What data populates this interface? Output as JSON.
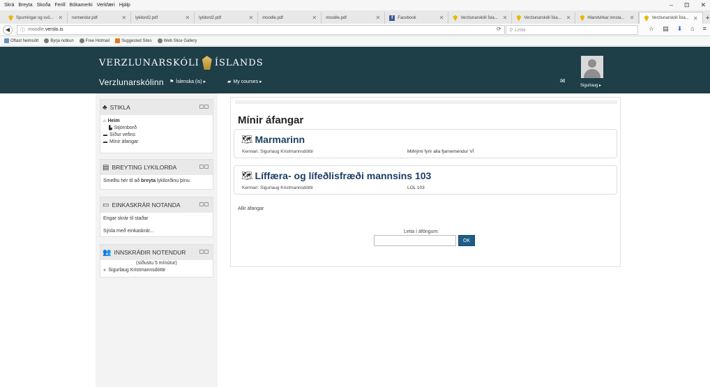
{
  "browser": {
    "menu": [
      "Skrá",
      "Breyta",
      "Skoða",
      "Ferill",
      "Bókamerki",
      "Verkfæri",
      "Hjálp"
    ],
    "window_controls": [
      "–",
      "⊡",
      "✕"
    ],
    "tabs": [
      {
        "label": "Spurningar og svö...",
        "icon": "yellow"
      },
      {
        "label": "nemendur.pdf",
        "icon": "none"
      },
      {
        "label": "lykilord2.pdf",
        "icon": "none"
      },
      {
        "label": "lykilord2.pdf",
        "icon": "none"
      },
      {
        "label": "moodle.pdf",
        "icon": "none"
      },
      {
        "label": "moodle.pdf",
        "icon": "none"
      },
      {
        "label": "Facebook",
        "icon": "facebook"
      },
      {
        "label": "Verzlunarskóli Ísla...",
        "icon": "yellow"
      },
      {
        "label": "Verzlunarskóli Ísla...",
        "icon": "yellow"
      },
      {
        "label": "Hlandvirkar innsta...",
        "icon": "yellow"
      },
      {
        "label": "Verzlunarskóli Ísla...",
        "icon": "yellow",
        "active": true
      }
    ],
    "tab_close": "✕",
    "new_tab": "+",
    "url_prefix": "moodle.",
    "url_domain": "verslo.is",
    "search_placeholder": "Leita",
    "bookmarks": [
      {
        "label": "Oftast heimsótt",
        "color": "#6c8ebf"
      },
      {
        "label": "Byrja notkun",
        "color": "#7a7a7a"
      },
      {
        "label": "Free Hotmail",
        "color": "#7a7a7a"
      },
      {
        "label": "Suggested Sites",
        "color": "#e07a1f"
      },
      {
        "label": "Web Slice Gallery",
        "color": "#7a7a7a"
      }
    ]
  },
  "header": {
    "brand_left": "VERZLUNARSKÓLI",
    "brand_right": "ÍSLANDS",
    "site_name": "Verzlunarskólinn",
    "language_menu": "Íslenska (is) ▸",
    "courses_menu": "My courses ▸",
    "user_name": "Sigurlaug ▸",
    "colors": {
      "header_bg": "#1e3e48",
      "link": "#1d3f63",
      "button": "#1f5d89"
    }
  },
  "blocks": {
    "navigation": {
      "title": "STIKLA",
      "items": [
        {
          "label": "Heim",
          "level": 0,
          "bold": true,
          "icon": "home-icon"
        },
        {
          "label": "Stjórnborð",
          "level": 1,
          "bold": false,
          "icon": "dashboard-icon"
        },
        {
          "label": "Síður vefins",
          "level": 0,
          "bold": false,
          "icon": "folder-icon"
        },
        {
          "label": "Mínir áfangar",
          "level": 0,
          "bold": false,
          "icon": "folder-icon"
        }
      ]
    },
    "password": {
      "title": "BREYTING LYKILORÐA",
      "text_before": "Smelltu hér til að ",
      "text_bold": "breyta",
      "text_after": " lykilorðinu þínu."
    },
    "private_files": {
      "title": "EINKASKRÁR NOTANDA",
      "empty": "Engar skrár til staðar",
      "manage": "Sýsla með einkaskrár..."
    },
    "online_users": {
      "title": "INNSKRÁÐIR NOTENDUR",
      "subtitle": "(síðustu 5 mínútur)",
      "users": [
        "Sigurlaug Kristmannsdóttir"
      ]
    }
  },
  "main": {
    "title": "Mínir áfangar",
    "courses": [
      {
        "name": "Marmarinn",
        "teacher": "Kennari: Sigurlaug Kristmannsdóttir",
        "summary": "Miðrými fyrir alla fjarnemendur VÍ"
      },
      {
        "name": "Líffæra- og lífeðlisfræði mannsins 103",
        "teacher": "Kennari: Sigurlaug Kristmannsdóttir",
        "summary": "LOL 103"
      }
    ],
    "all_courses": "Allir áfangar",
    "search_label": "Leita í áföngum:",
    "search_value": "",
    "search_button": "OK"
  }
}
